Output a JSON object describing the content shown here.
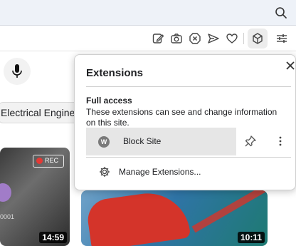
{
  "toolbar": {
    "icons": [
      "edit-note-icon",
      "camera-icon",
      "blocker-icon",
      "send-icon",
      "heart-icon",
      "extensions-icon",
      "sliders-icon"
    ]
  },
  "page": {
    "filter_chip": "Electrical Engineer",
    "thumbnails": [
      {
        "badge": "REC",
        "subtext": "0001",
        "duration": "14:59"
      },
      {
        "duration": "10:11"
      }
    ]
  },
  "popup": {
    "title": "Extensions",
    "section_title": "Full access",
    "section_description": "These extensions can see and change information on this site.",
    "extensions": [
      {
        "name": "Block Site",
        "logo_letter": "W"
      }
    ],
    "manage_label": "Manage Extensions..."
  }
}
